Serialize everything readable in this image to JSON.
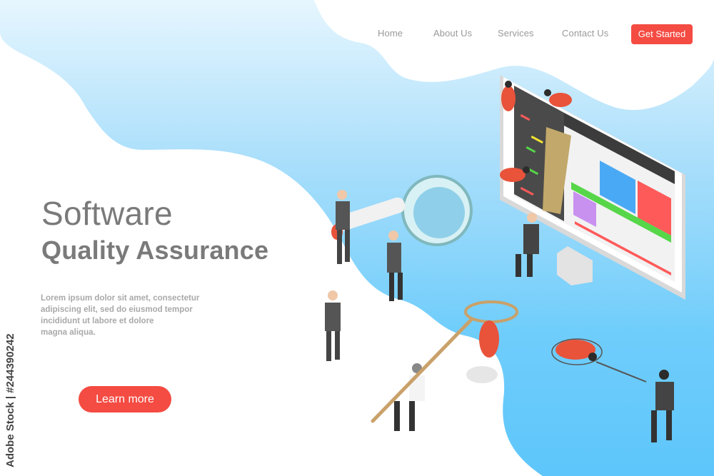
{
  "nav": {
    "items": [
      {
        "label": "Home"
      },
      {
        "label": "About Us"
      },
      {
        "label": "Services"
      },
      {
        "label": "Contact Us"
      }
    ],
    "cta_label": "Get Started"
  },
  "hero": {
    "title_line1": "Software",
    "title_line2": "Quality Assurance",
    "description_lines": [
      "Lorem ipsum dolor sit amet, consectetur",
      "adipiscing elit, sed do eiusmod tempor",
      "incididunt ut labore et dolore",
      "magna aliqua."
    ],
    "button_label": "Learn more"
  },
  "watermark": {
    "side_text": "Adobe Stock | #244390242"
  },
  "illustration": {
    "subject": "isometric software testers catching bugs around a computer monitor",
    "elements": [
      "monitor-with-code",
      "bugs",
      "magnifying-glass",
      "butterfly-nets",
      "business-people"
    ]
  },
  "colors": {
    "accent": "#f44b42",
    "blue_light": "#d9f1fd",
    "blue": "#5ec6fb",
    "text_gray": "#7a7a7a",
    "nav_gray": "#9a9a9a"
  }
}
